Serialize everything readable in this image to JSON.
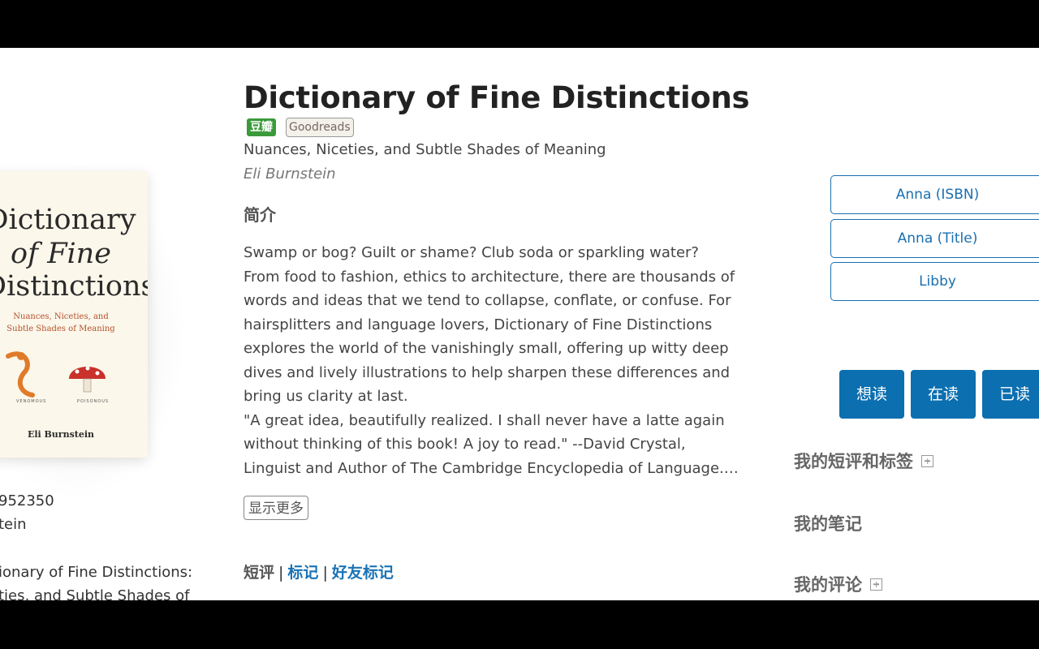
{
  "book": {
    "title": "Dictionary of Fine Distinctions",
    "subtitle": "Nuances, Niceties, and Subtle Shades of Meaning",
    "author": "Eli Burnstein",
    "badges": {
      "douban": "豆瓣",
      "goodreads": "Goodreads"
    }
  },
  "cover": {
    "line1": "Dictionary",
    "line2": "of Fine",
    "line3": "Distinctions",
    "tagline1": "Nuances, Niceties, and",
    "tagline2": "Subtle Shades of Meaning",
    "author": "Eli Burnstein",
    "caption_left": "VENOMOUS",
    "caption_right": "POISONOUS"
  },
  "meta_partial": {
    "isbn_fragment": "952350",
    "author_fragment": "tein",
    "title_fragment1": "ionary of Fine Distinctions:",
    "title_fragment2": "ties, and Subtle Shades of"
  },
  "intro": {
    "heading": "简介",
    "paragraph1": "Swamp or bog? Guilt or shame? Club soda or sparkling water? From food to fashion, ethics to architecture, there are thousands of words and ideas that we tend to collapse, conflate, or confuse. For hairsplitters and language lovers, Dictionary of Fine Distinctions explores the world of the vanishingly small, offering up witty deep dives and lively illustrations to help sharpen these differences and bring us clarity at last.",
    "paragraph2": "\"A great idea, beautifully realized. I shall never have a latte again without thinking of this book! A joy to read.\" --David Crystal, Linguist and Author of The Cambridge Encyclopedia of Language.…",
    "show_more": "显示更多"
  },
  "tabs": {
    "reviews": "短评",
    "marks": "标记",
    "friend_marks": "好友标记",
    "separator": "|"
  },
  "links": [
    "Anna (ISBN)",
    "Anna (Title)",
    "Libby"
  ],
  "shelf": {
    "want": "想读",
    "reading": "在读",
    "read": "已读"
  },
  "sidebar": {
    "short_review_tags": "我的短评和标签",
    "notes": "我的笔记",
    "reviews": "我的评论"
  },
  "colors": {
    "link": "#1a6fb0",
    "shelf_button": "#0c6fb0",
    "douban_green": "#3a9a3a"
  }
}
